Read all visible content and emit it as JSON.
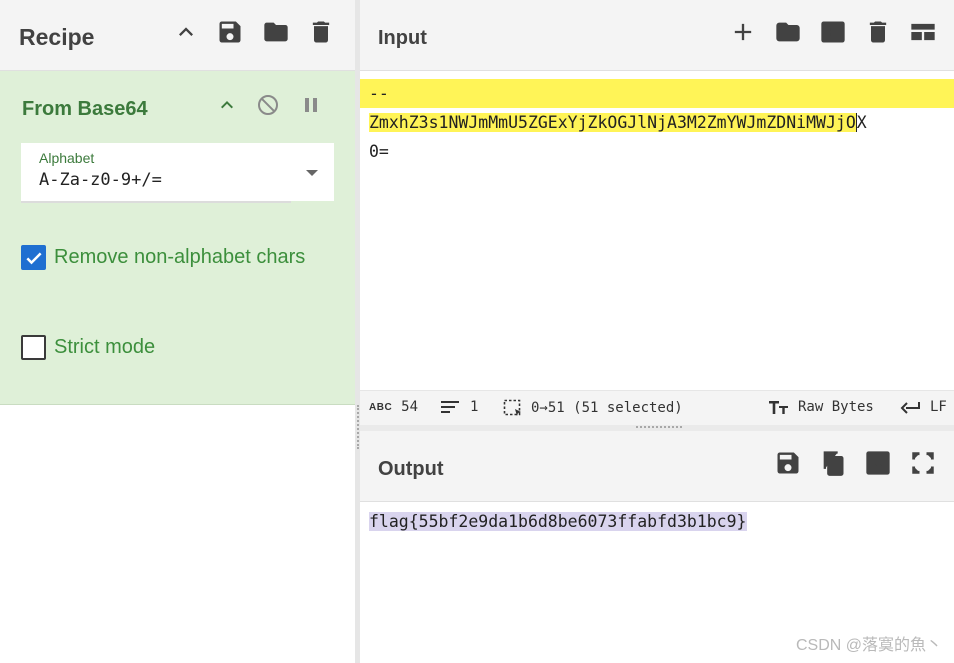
{
  "recipe": {
    "title": "Recipe",
    "toolbar_icons": [
      "chevron-up-icon",
      "save-icon",
      "folder-icon",
      "trash-icon"
    ],
    "operation": {
      "name": "From Base64",
      "icons": [
        "chevron-up-icon",
        "disable-icon",
        "pause-icon"
      ],
      "alphabet": {
        "label": "Alphabet",
        "value": "A-Za-z0-9+/="
      },
      "remove_non_alphabet": {
        "label": "Remove non-alphabet chars",
        "checked": true
      },
      "strict_mode": {
        "label": "Strict mode",
        "checked": false
      }
    }
  },
  "input": {
    "title": "Input",
    "toolbar_icons": [
      "plus-icon",
      "folder-icon",
      "import-icon",
      "trash-icon",
      "layout-icon"
    ],
    "lines": [
      "--",
      "ZmxhZ3s1NWJmMmU5ZGExYjZkOGJlNjA3M2ZmYWJmZDNiMWJjOX",
      "0="
    ],
    "line2_selected": "ZmxhZ3s1NWJmMmU5ZGExYjZkOGJlNjA3M2ZmYWJmZDNiMWJjO",
    "line2_rest": "X",
    "status": {
      "length_label": "ABC",
      "length": "54",
      "lines": "1",
      "selection": "0→51 (51 selected)",
      "encoding": "Raw Bytes",
      "eol": "LF"
    }
  },
  "output": {
    "title": "Output",
    "toolbar_icons": [
      "save-icon",
      "copy-icon",
      "replace-input-icon",
      "fullscreen-icon"
    ],
    "text": "flag{55bf2e9da1b6d8be6073ffabfd3b1bc9}"
  },
  "watermark": "CSDN @落寞的魚丶",
  "colors": {
    "operation_bg": "#dff0d8",
    "operation_text": "#3c7a3c",
    "input_highlight": "#fff457",
    "output_highlight": "#d9d4ee",
    "checkbox_checked": "#1f6fd1"
  }
}
